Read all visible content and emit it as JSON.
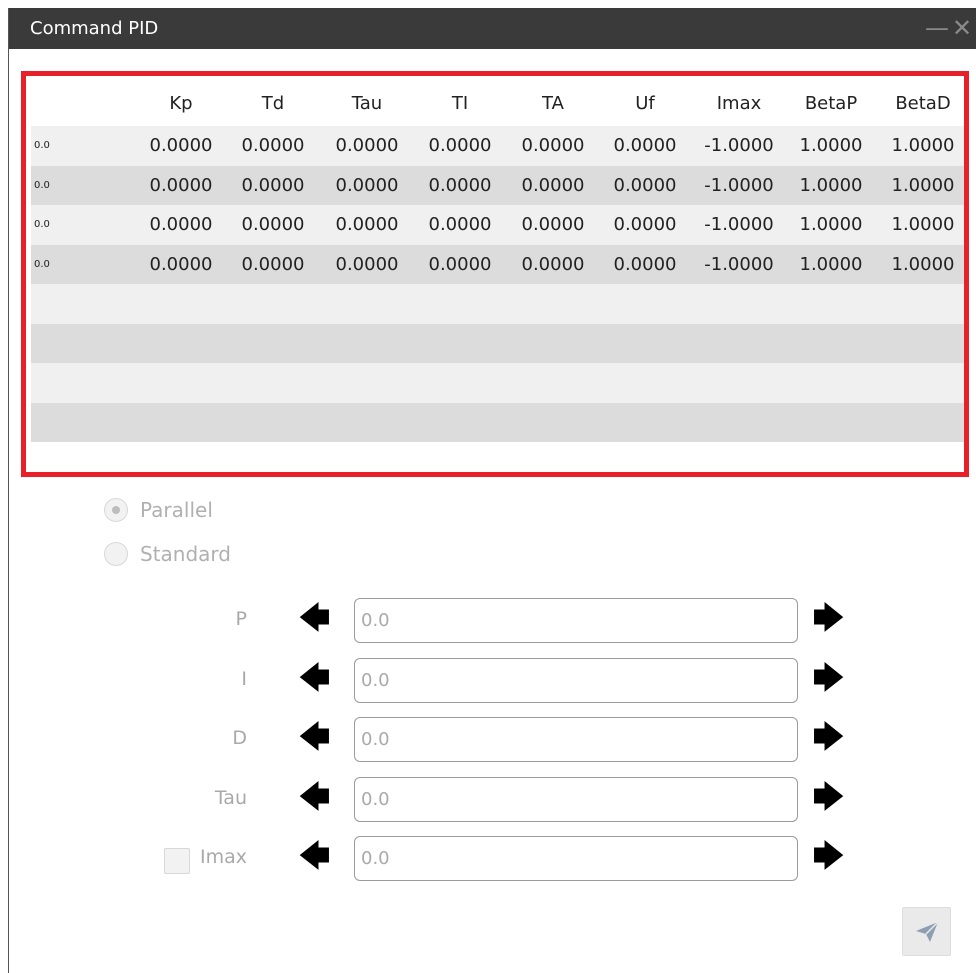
{
  "window": {
    "title": "Command PID",
    "minimize_icon": "minimize-icon",
    "close_icon": "close-icon"
  },
  "table": {
    "columns": [
      "",
      "Kp",
      "Td",
      "Tau",
      "TI",
      "TA",
      "Uf",
      "Imax",
      "BetaP",
      "BetaD"
    ],
    "rows": [
      {
        "index": "0.0",
        "values": [
          "0.0000",
          "0.0000",
          "0.0000",
          "0.0000",
          "0.0000",
          "0.0000",
          "-1.0000",
          "1.0000",
          "1.0000"
        ]
      },
      {
        "index": "0.0",
        "values": [
          "0.0000",
          "0.0000",
          "0.0000",
          "0.0000",
          "0.0000",
          "0.0000",
          "-1.0000",
          "1.0000",
          "1.0000"
        ]
      },
      {
        "index": "0.0",
        "values": [
          "0.0000",
          "0.0000",
          "0.0000",
          "0.0000",
          "0.0000",
          "0.0000",
          "-1.0000",
          "1.0000",
          "1.0000"
        ]
      },
      {
        "index": "0.0",
        "values": [
          "0.0000",
          "0.0000",
          "0.0000",
          "0.0000",
          "0.0000",
          "0.0000",
          "-1.0000",
          "1.0000",
          "1.0000"
        ]
      }
    ],
    "highlight_color": "#e8202a"
  },
  "mode": {
    "options": [
      {
        "label": "Parallel",
        "selected": true
      },
      {
        "label": "Standard",
        "selected": false
      }
    ]
  },
  "params": [
    {
      "label": "P",
      "placeholder": "0.0",
      "value": ""
    },
    {
      "label": "I",
      "placeholder": "0.0",
      "value": ""
    },
    {
      "label": "D",
      "placeholder": "0.0",
      "value": ""
    },
    {
      "label": "Tau",
      "placeholder": "0.0",
      "value": ""
    },
    {
      "label": "Imax",
      "placeholder": "0.0",
      "value": "",
      "checkbox": true
    }
  ],
  "icons": {
    "left": "arrow-left-icon",
    "right": "arrow-right-icon",
    "send": "send-icon"
  }
}
